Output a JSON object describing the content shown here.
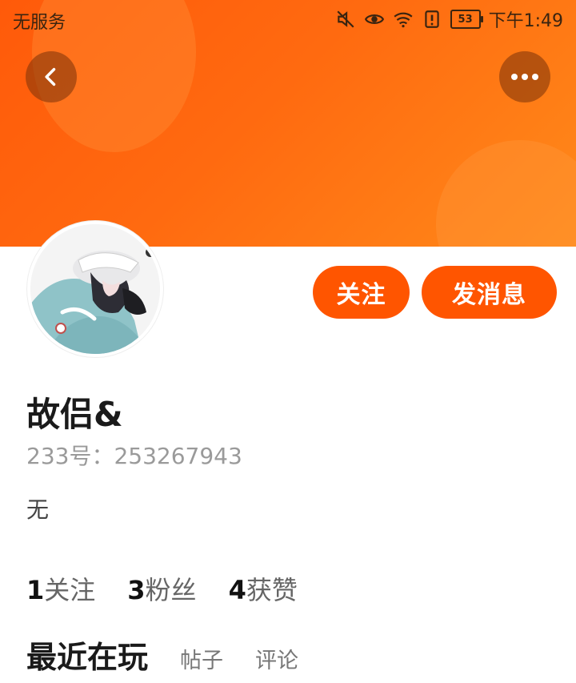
{
  "status_bar": {
    "carrier": "无服务",
    "battery": "53",
    "time": "下午1:49",
    "icons": [
      "mute-icon",
      "eye-icon",
      "wifi-icon",
      "alert-icon",
      "battery-icon"
    ]
  },
  "header": {
    "gradient_start": "#ff5a0a",
    "gradient_end": "#ff8a1a",
    "back_icon": "chevron-left-icon",
    "more_icon": "more-dots-icon"
  },
  "profile": {
    "username": "故侣&",
    "uid": "233号：253267943",
    "bio": "无",
    "follow_label": "关注",
    "message_label": "发消息",
    "accent": "#ff5500"
  },
  "stats": [
    {
      "count": "1",
      "label": "关注"
    },
    {
      "count": "3",
      "label": "粉丝"
    },
    {
      "count": "4",
      "label": "获赞"
    }
  ],
  "tabs": [
    {
      "label": "最近在玩",
      "active": true
    },
    {
      "label": "帖子",
      "active": false
    },
    {
      "label": "评论",
      "active": false
    }
  ]
}
